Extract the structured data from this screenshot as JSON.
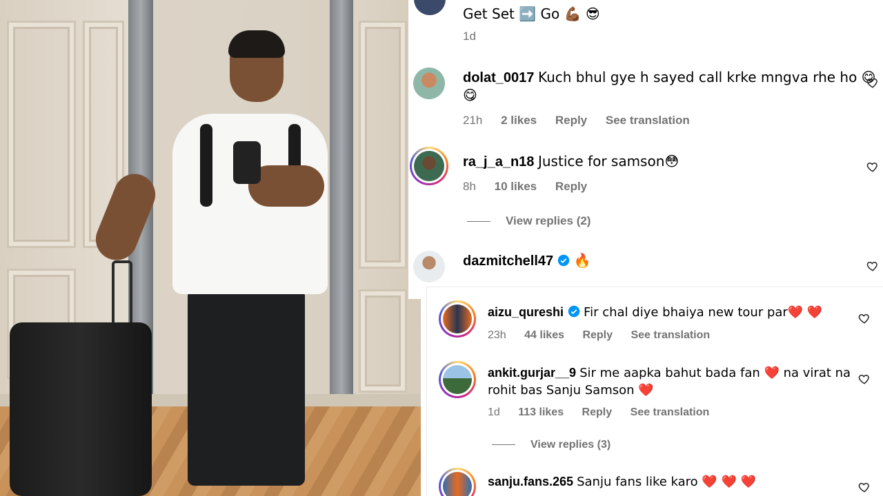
{
  "top_comment": {
    "text": "Get Set ➡️ Go 💪🏾 😎",
    "time": "1d"
  },
  "comments_a": [
    {
      "username": "dolat_0017",
      "text_line1": "Kuch bhul gye h sayed call krke mngva rhe ho 😋",
      "text_line2": "😋",
      "time": "21h",
      "likes": "2 likes",
      "reply": "Reply",
      "translate": "See translation"
    },
    {
      "username": "ra_j_a_n18",
      "text": "Justice for samson😳",
      "time": "8h",
      "likes": "10 likes",
      "reply": "Reply",
      "view_replies": "View replies (2)"
    },
    {
      "username": "dazmitchell47",
      "text": "🔥"
    }
  ],
  "comments_b": [
    {
      "username": "aizu_qureshi",
      "text": "Fir chal diye bhaiya new tour par❤️ ❤️",
      "time": "23h",
      "likes": "44 likes",
      "reply": "Reply",
      "translate": "See translation"
    },
    {
      "username": "ankit.gurjar__9",
      "text_line1": "Sir me aapka bahut bada fan ❤️ na virat na",
      "text_line2": "rohit bas Sanju Samson ❤️",
      "time": "1d",
      "likes": "113 likes",
      "reply": "Reply",
      "translate": "See translation",
      "view_replies": "View replies (3)"
    },
    {
      "username": "sanju.fans.265",
      "text": "Sanju fans like karo ❤️ ❤️ ❤️"
    }
  ],
  "colors": {
    "meta_gray": "#737373",
    "verified_blue": "#0095f6",
    "story_ring": "#d62976"
  }
}
